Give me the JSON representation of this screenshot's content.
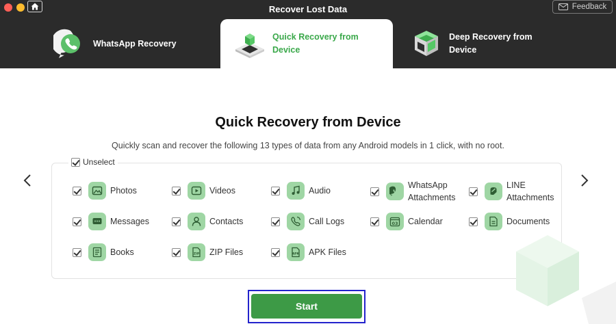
{
  "window": {
    "title": "Recover Lost Data",
    "feedback_label": "Feedback"
  },
  "tabs": [
    {
      "label": "WhatsApp Recovery",
      "active": false
    },
    {
      "label": "Quick Recovery from Device",
      "active": true
    },
    {
      "label": "Deep Recovery from Device",
      "active": false
    }
  ],
  "main": {
    "title": "Quick Recovery from Device",
    "subtitle": "Quickly scan and recover the following 13 types of data from any Android models in 1 click, with no root.",
    "unselect_label": "Unselect",
    "start_label": "Start"
  },
  "data_types": [
    {
      "label": "Photos",
      "icon": "photos-icon",
      "checked": true
    },
    {
      "label": "Videos",
      "icon": "videos-icon",
      "checked": true
    },
    {
      "label": "Audio",
      "icon": "audio-icon",
      "checked": true
    },
    {
      "label": "WhatsApp Attachments",
      "icon": "whatsapp-icon",
      "checked": true
    },
    {
      "label": "LINE Attachments",
      "icon": "line-icon",
      "checked": true
    },
    {
      "label": "Messages",
      "icon": "messages-icon",
      "checked": true
    },
    {
      "label": "Contacts",
      "icon": "contacts-icon",
      "checked": true
    },
    {
      "label": "Call Logs",
      "icon": "call-logs-icon",
      "checked": true
    },
    {
      "label": "Calendar",
      "icon": "calendar-icon",
      "checked": true
    },
    {
      "label": "Documents",
      "icon": "documents-icon",
      "checked": true
    },
    {
      "label": "Books",
      "icon": "books-icon",
      "checked": true
    },
    {
      "label": "ZIP Files",
      "icon": "zip-files-icon",
      "checked": true
    },
    {
      "label": "APK Files",
      "icon": "apk-files-icon",
      "checked": true
    }
  ],
  "icon_glyphs": {
    "calendar": "03",
    "zip": "ZIP",
    "apk": "APK"
  },
  "colors": {
    "accent": "#3d9a46",
    "active_tab_text": "#3aa84a",
    "titlebar": "#2b2b2b",
    "icon_bg": "#9fd6a4"
  }
}
